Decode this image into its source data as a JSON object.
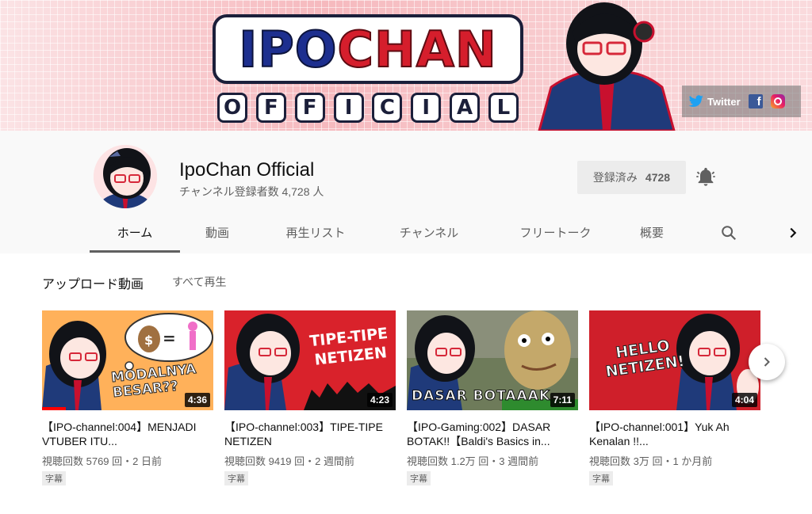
{
  "banner": {
    "logo_ipo": "IPO",
    "logo_chan": "CHAN",
    "logo_official": [
      "O",
      "F",
      "F",
      "I",
      "C",
      "I",
      "A",
      "L"
    ],
    "social": {
      "twitter_label": "Twitter",
      "facebook_glyph": "f"
    }
  },
  "channel": {
    "name": "IpoChan Official",
    "subscribers": "チャンネル登録者数 4,728 人",
    "subscribe_label": "登録済み",
    "subscribe_count": "4728"
  },
  "tabs": [
    "ホーム",
    "動画",
    "再生リスト",
    "チャンネル",
    "フリートーク",
    "概要"
  ],
  "section": {
    "title": "アップロード動画",
    "play_all": "すべて再生"
  },
  "videos": [
    {
      "title": "【IPO-channel:004】MENJADI VTUBER ITU...",
      "meta": "視聴回数 5769 回・2 日前",
      "badge": "字幕",
      "duration": "4:36",
      "thumb_text": "MODALNYA BESAR??",
      "progress": 0.14
    },
    {
      "title": "【IPO-channel:003】TIPE-TIPE NETIZEN",
      "meta": "視聴回数 9419 回・2 週間前",
      "badge": "字幕",
      "duration": "4:23",
      "thumb_text": "TIPE-TIPE NETIZEN"
    },
    {
      "title": "【IPO-Gaming:002】DASAR BOTAK!!【Baldi's Basics in...",
      "meta": "視聴回数 1.2万 回・3 週間前",
      "badge": "字幕",
      "duration": "7:11",
      "thumb_text": "DASAR BOTAAAK"
    },
    {
      "title": "【IPO-channel:001】Yuk Ah Kenalan !!...",
      "meta": "視聴回数 3万 回・1 か月前",
      "badge": "字幕",
      "duration": "4:04",
      "thumb_text": "HELLO NETIZEN!"
    }
  ],
  "colors": {
    "accent_red": "#ff0000",
    "logo_blue": "#1d2f8f",
    "logo_red": "#d51e2c"
  }
}
